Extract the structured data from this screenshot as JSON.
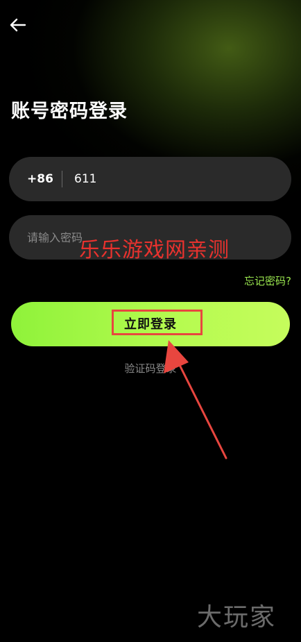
{
  "header": {
    "back_icon": "arrow-left-icon",
    "title": "账号密码登录"
  },
  "form": {
    "country_code": "+86",
    "phone_value": "611",
    "password_placeholder": "请输入密码",
    "forgot_label": "忘记密码?",
    "login_label": "立即登录",
    "sms_login_label": "验证码登录"
  },
  "overlay": {
    "watermark_text": "乐乐游戏网亲测",
    "highlight_color": "#e8463f",
    "watermark_color": "#e8322e"
  },
  "footer": {
    "brand_text": "大玩家"
  },
  "colors": {
    "accent": "#9be84f",
    "button_gradient_start": "#8ff23a",
    "button_gradient_end": "#c5fc5c",
    "field_background": "#2a2a2a"
  }
}
